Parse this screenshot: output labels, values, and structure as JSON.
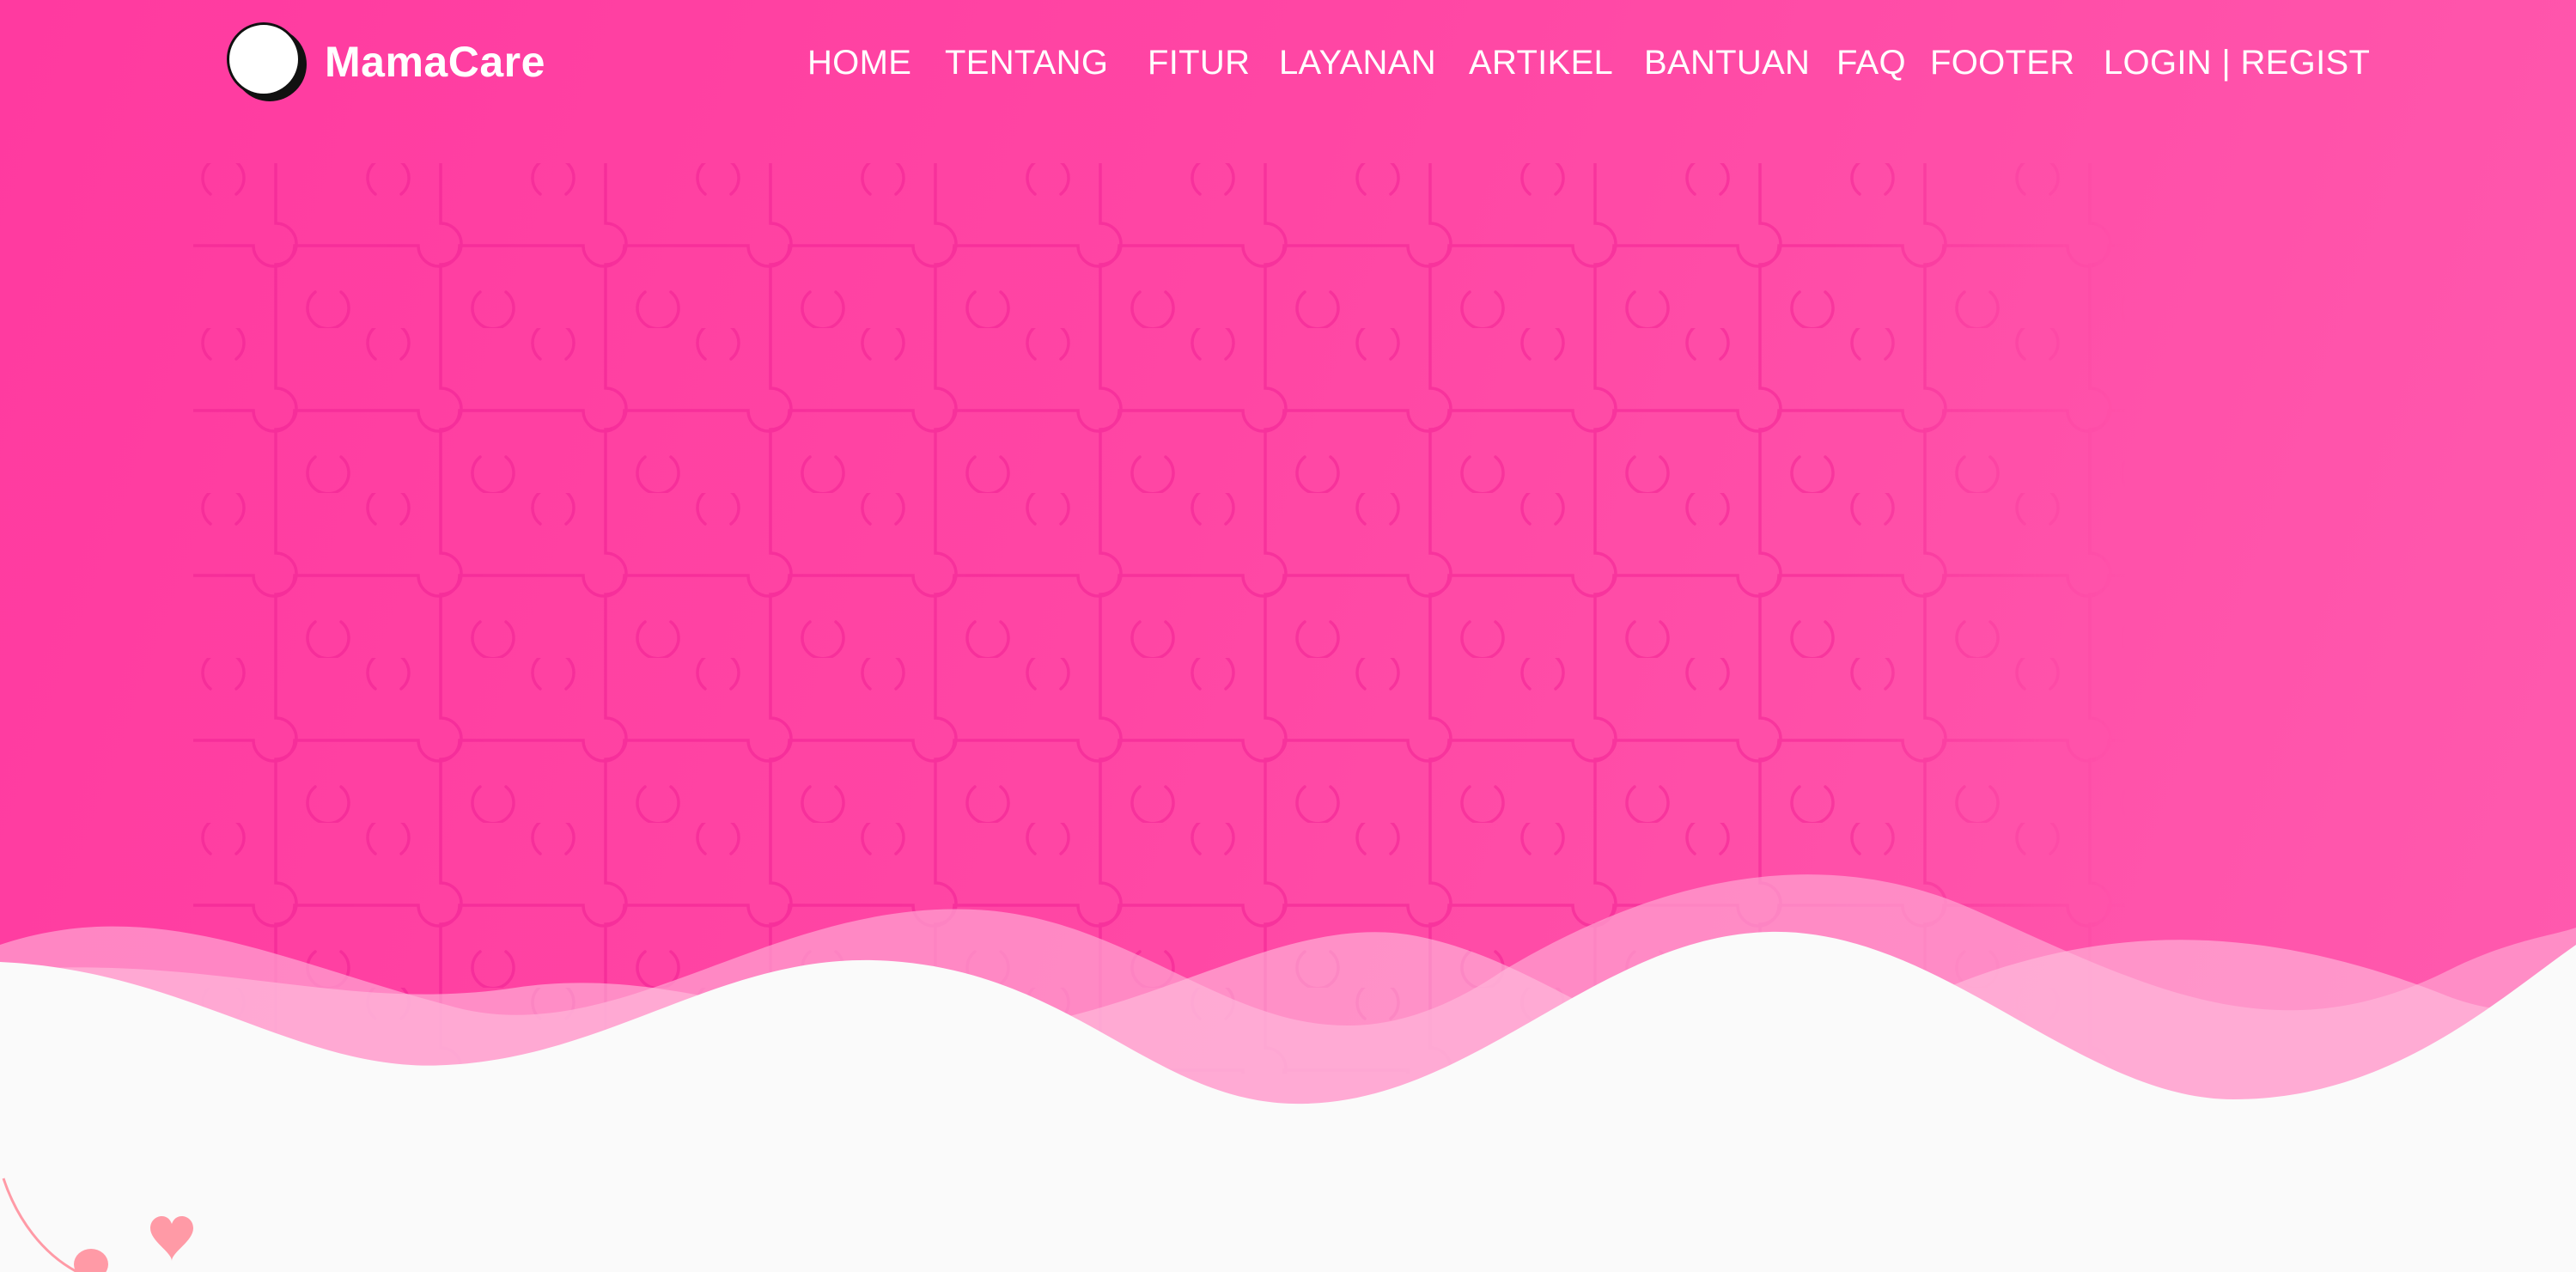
{
  "brand": {
    "name": "MamaCare",
    "logo_icon": "logo-circle-icon"
  },
  "nav": {
    "items": [
      {
        "label": "HOME"
      },
      {
        "label": "TENTANG"
      },
      {
        "label": "FITUR"
      },
      {
        "label": "LAYANAN"
      },
      {
        "label": "ARTIKEL"
      },
      {
        "label": "BANTUAN"
      },
      {
        "label": "FAQ"
      },
      {
        "label": "FOOTER"
      }
    ],
    "auth_label": "LOGIN | REGIST"
  },
  "colors": {
    "hero_pink": "#ff3aa0",
    "puzzle_line": "#f72a98",
    "wave_light": "#ffa6d2",
    "page_background": "#fafafa",
    "heart": "#ff9aa6"
  },
  "decorations": {
    "background_pattern": "puzzle-pattern",
    "divider": "wave-divider",
    "corner_icon": "heart-icon"
  }
}
